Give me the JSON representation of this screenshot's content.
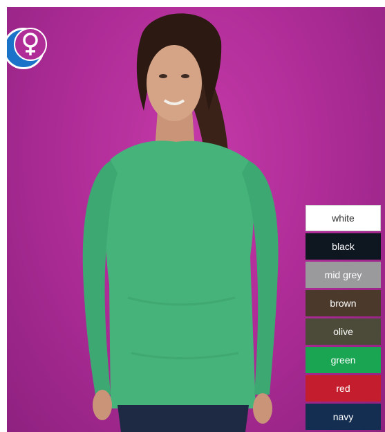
{
  "product": {
    "gender_icon": "female-symbol-icon",
    "swatches": [
      {
        "label": "white",
        "color": "#ffffff",
        "text_color": "#333333"
      },
      {
        "label": "black",
        "color": "#0e1620",
        "text_color": "#ffffff"
      },
      {
        "label": "mid grey",
        "color": "#9a9a9c",
        "text_color": "#ffffff"
      },
      {
        "label": "brown",
        "color": "#4b3a2c",
        "text_color": "#ffffff"
      },
      {
        "label": "olive",
        "color": "#4c4a38",
        "text_color": "#ffffff"
      },
      {
        "label": "green",
        "color": "#1aa552",
        "text_color": "#ffffff"
      },
      {
        "label": "red",
        "color": "#c41e2e",
        "text_color": "#ffffff"
      },
      {
        "label": "navy",
        "color": "#142e52",
        "text_color": "#ffffff"
      }
    ]
  }
}
